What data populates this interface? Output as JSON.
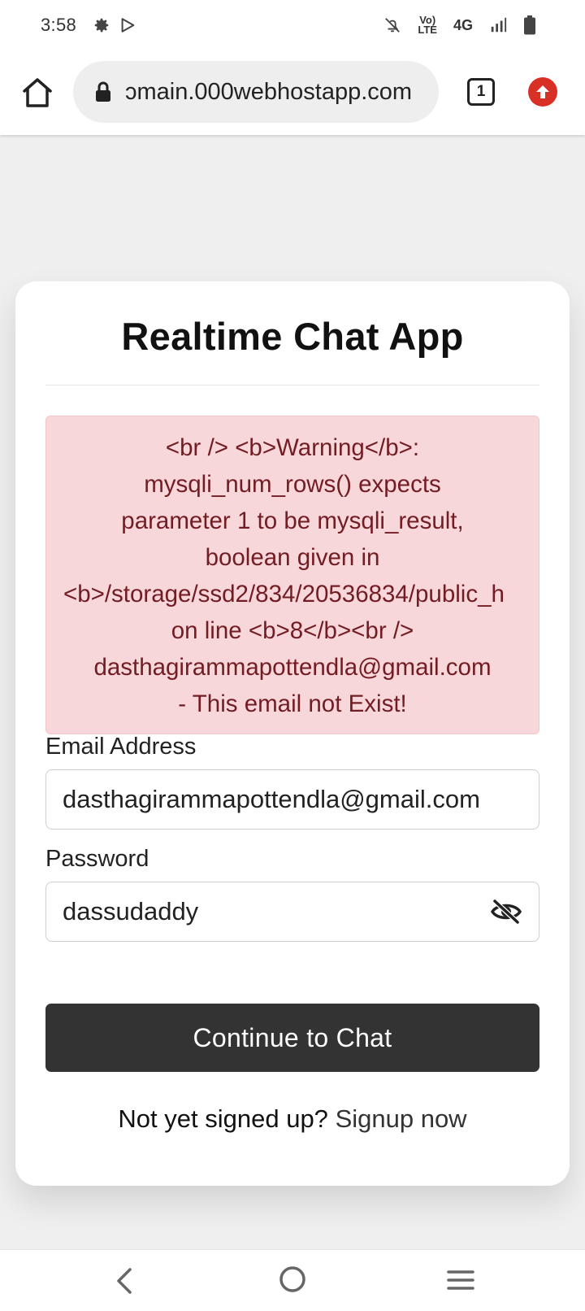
{
  "status_bar": {
    "time": "3:58",
    "left_icons": [
      "settings-icon",
      "play-store-icon"
    ],
    "right_icons": [
      "mute-icon",
      "volte-icon",
      "network-4g",
      "signal-icon",
      "battery-icon"
    ],
    "volte_label": "Vo) LTE",
    "network_label": "4G"
  },
  "browser": {
    "url": "000webhostapp.com",
    "url_visible": "ɔmain.000webhostapp.com",
    "tab_count": "1",
    "accent_update": "#d93025"
  },
  "card": {
    "title": "Realtime Chat App",
    "error": {
      "lines": [
        "<br /> <b>Warning</b>:",
        "mysqli_num_rows() expects",
        "parameter 1 to be mysqli_result,",
        "boolean given in",
        "<b>/storage/ssd2/834/20536834/public_h",
        "on line <b>8</b><br />",
        "dasthagirammapottendla@gmail.com",
        "- This email not Exist!"
      ],
      "bg_color": "#f8d7da",
      "text_color": "#721c24"
    },
    "email": {
      "label": "Email Address",
      "value": "dasthagirammapottendla@gmail.com"
    },
    "password": {
      "label": "Password",
      "value": "dassudaddy",
      "toggle_icon": "eye-slash-icon"
    },
    "submit_label": "Continue to Chat",
    "signup_prompt": "Not yet signed up?",
    "signup_link": "Signup now"
  },
  "nav_bar": {
    "icons": [
      "back-icon",
      "home-circle-icon",
      "recents-icon"
    ]
  }
}
